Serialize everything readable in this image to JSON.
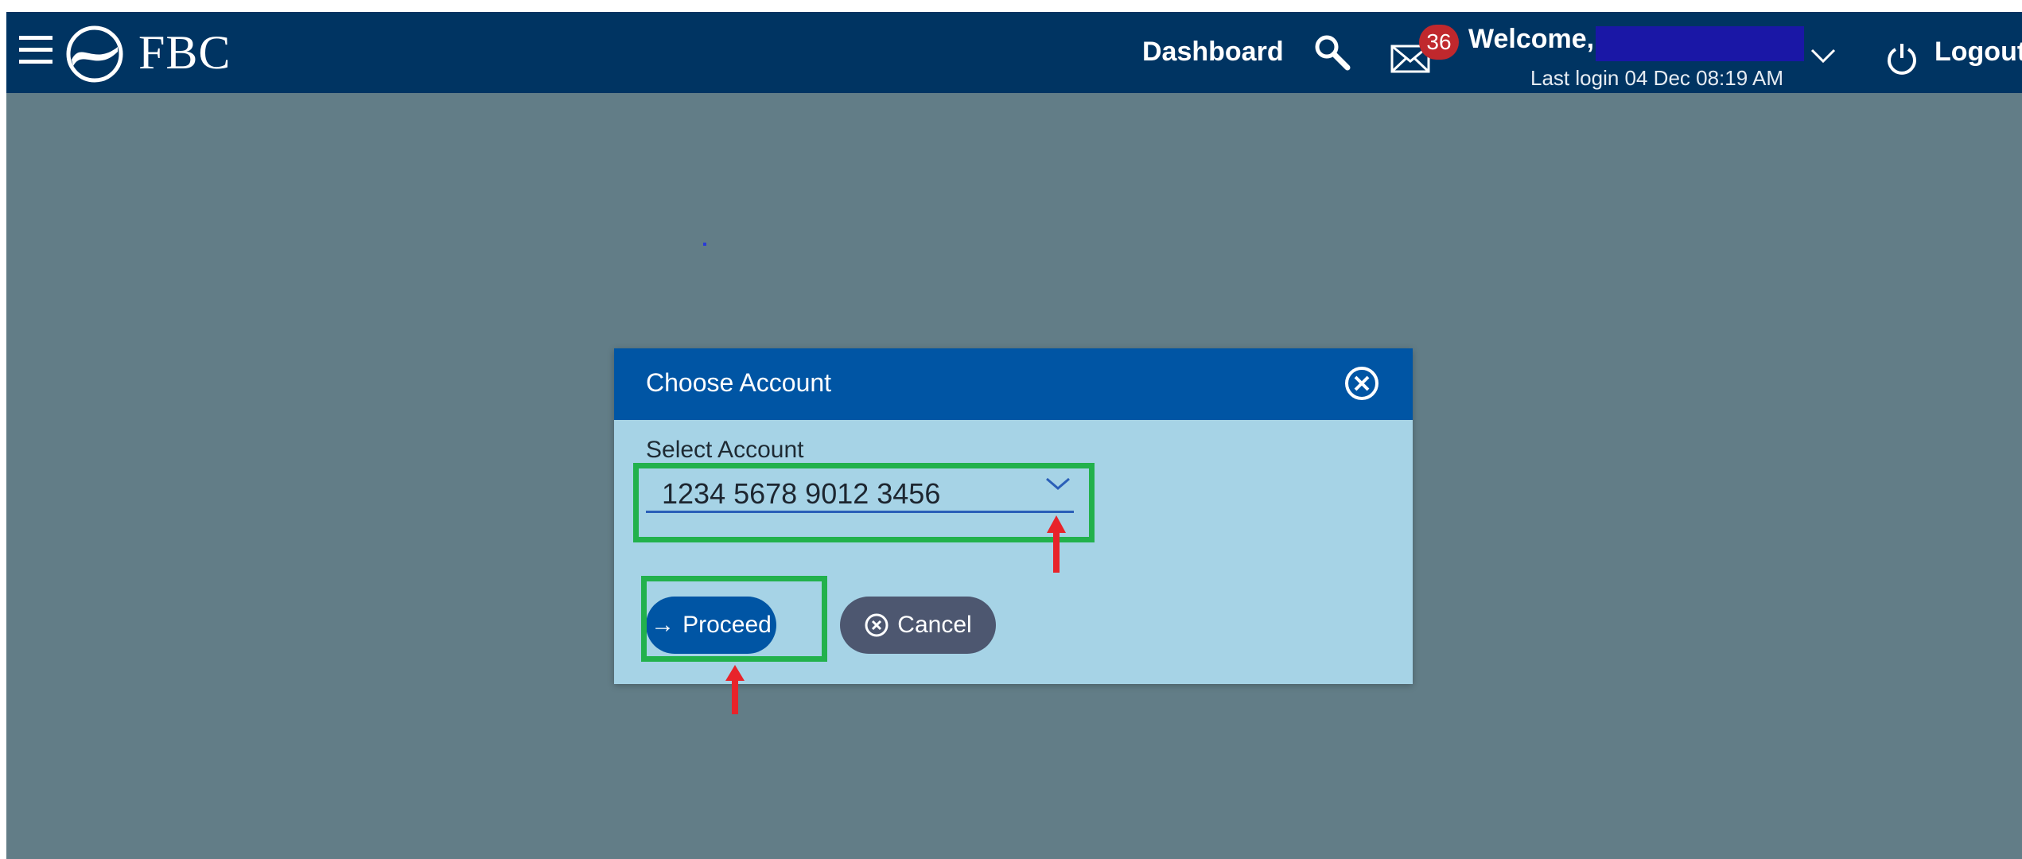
{
  "header": {
    "brand": "FBC",
    "nav_dashboard": "Dashboard",
    "mail_count": "36",
    "welcome": "Welcome,",
    "last_login": "Last login 04 Dec 08:19 AM",
    "logout": "Logout",
    "icons": [
      "menu-icon",
      "logo-icon",
      "search-icon",
      "mail-icon",
      "chevron-down-icon",
      "power-icon"
    ]
  },
  "modal": {
    "title": "Choose Account",
    "field_label": "Select Account",
    "selected_account": "1234 5678 9012 3456",
    "proceed_label": "Proceed",
    "cancel_label": "Cancel",
    "proceed_icon": "→"
  },
  "colors": {
    "header_bg": "#003462",
    "page_bg": "#627d87",
    "modal_bg": "#a6d3e6",
    "modal_header_bg": "#0055a4",
    "proceed_bg": "#0055a4",
    "cancel_bg": "#4d5770",
    "badge_bg": "#c0282d",
    "highlight": "#22b14c",
    "arrow": "#e8232a"
  }
}
